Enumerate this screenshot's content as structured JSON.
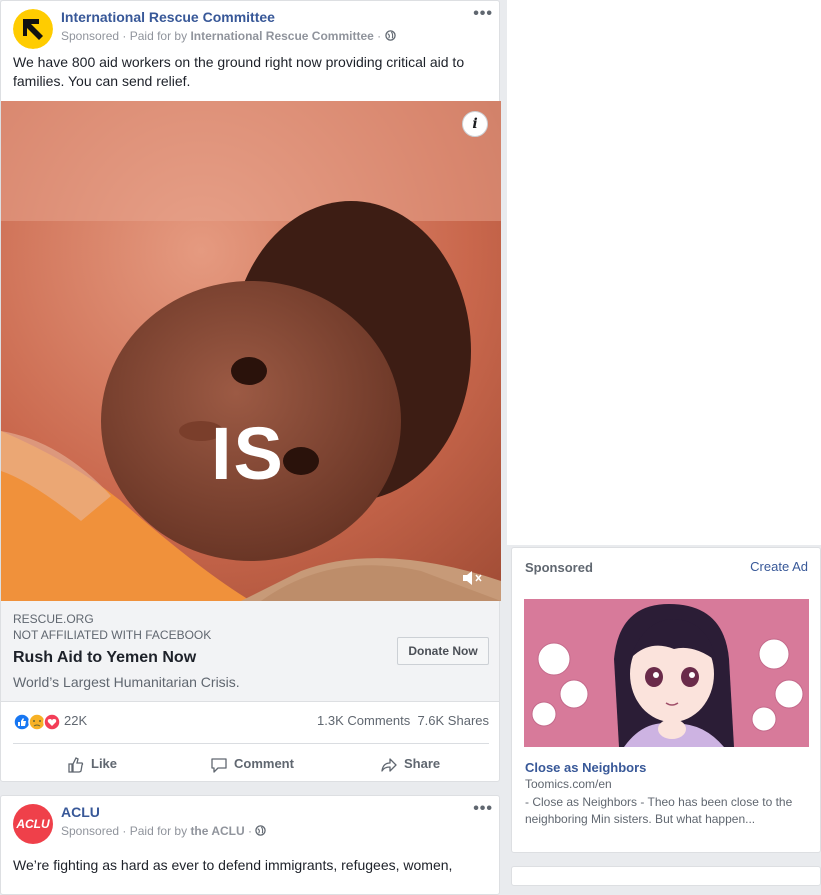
{
  "post1": {
    "page_name": "International Rescue Committee",
    "sponsored": "Sponsored",
    "paid_for_prefix": "· Paid for by",
    "paid_for_by": "International Rescue Committee",
    "text": "We have 800 aid workers on the ground right now providing critical aid to families. You can send relief.",
    "video_overlay_text": "IS",
    "link": {
      "domain": "RESCUE.ORG",
      "not_affiliated": "NOT AFFILIATED WITH FACEBOOK",
      "headline": "Rush Aid to Yemen Now",
      "description": "World’s Largest Humanitarian Crisis.",
      "cta": "Donate Now"
    },
    "reactions_count": "22K",
    "comments": "1.3K Comments",
    "shares": "7.6K Shares",
    "actions": {
      "like": "Like",
      "comment": "Comment",
      "share": "Share"
    }
  },
  "post2": {
    "page_name": "ACLU",
    "avatar_text": "ACLU",
    "sponsored": "Sponsored",
    "paid_for_prefix": "· Paid for by",
    "paid_for_by": "the ACLU",
    "text": "We’re fighting as hard as ever to defend immigrants, refugees, women,"
  },
  "right_ad": {
    "header": "Sponsored",
    "create_ad": "Create Ad",
    "title": "Close as Neighbors",
    "url": "Toomics.com/en",
    "description": "- Close as Neighbors - Theo has been close to the neighboring Min sisters. But what happen..."
  },
  "colors": {
    "link_blue": "#385898",
    "irc_yellow": "#ffcc00",
    "aclu_red": "#ef404a",
    "video_tint": "#d46a4a"
  }
}
